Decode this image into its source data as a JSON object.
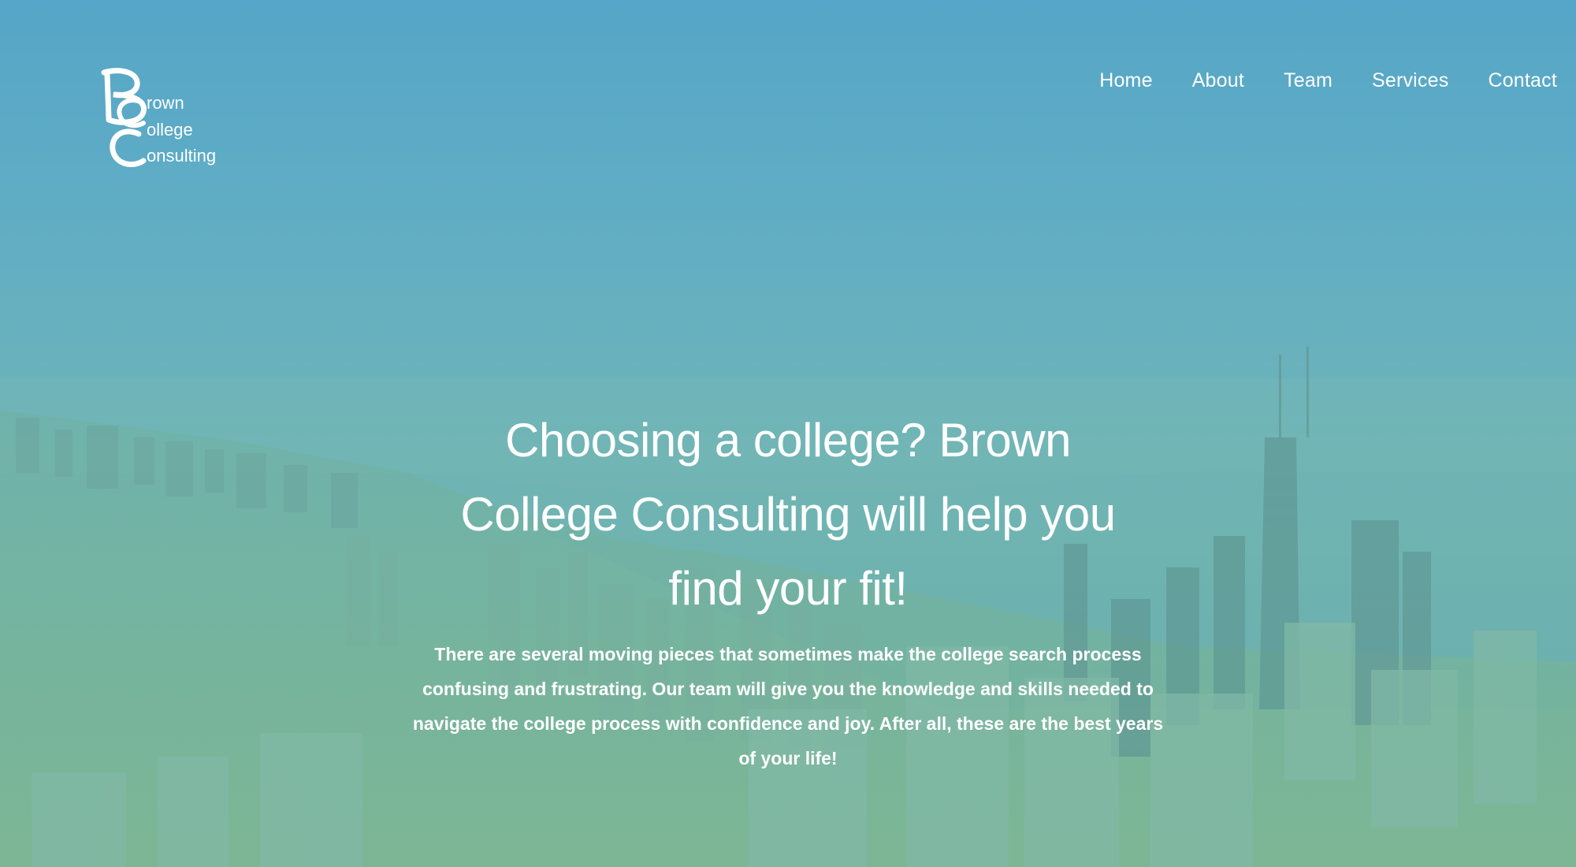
{
  "header": {
    "logo": {
      "icon": "bcc-logo-icon",
      "lines": [
        "rown",
        "ollege",
        "onsulting"
      ],
      "full_name": "Brown College Consulting"
    },
    "nav": [
      {
        "label": "Home"
      },
      {
        "label": "About"
      },
      {
        "label": "Team"
      },
      {
        "label": "Services"
      },
      {
        "label": "Contact"
      }
    ]
  },
  "hero": {
    "headline": "Choosing a college? Brown College Consulting will help you find your fit!",
    "body": "There are several moving pieces that sometimes make the college search process confusing and frustrating. Our team will give you the knowledge and skills needed to navigate the college process with confidence and joy. After all, these are the best years of your life!",
    "background": "city-skyline-image"
  },
  "colors": {
    "sky_top": "#4fa0cc",
    "ground": "#8cbd92",
    "text": "#ffffff"
  }
}
